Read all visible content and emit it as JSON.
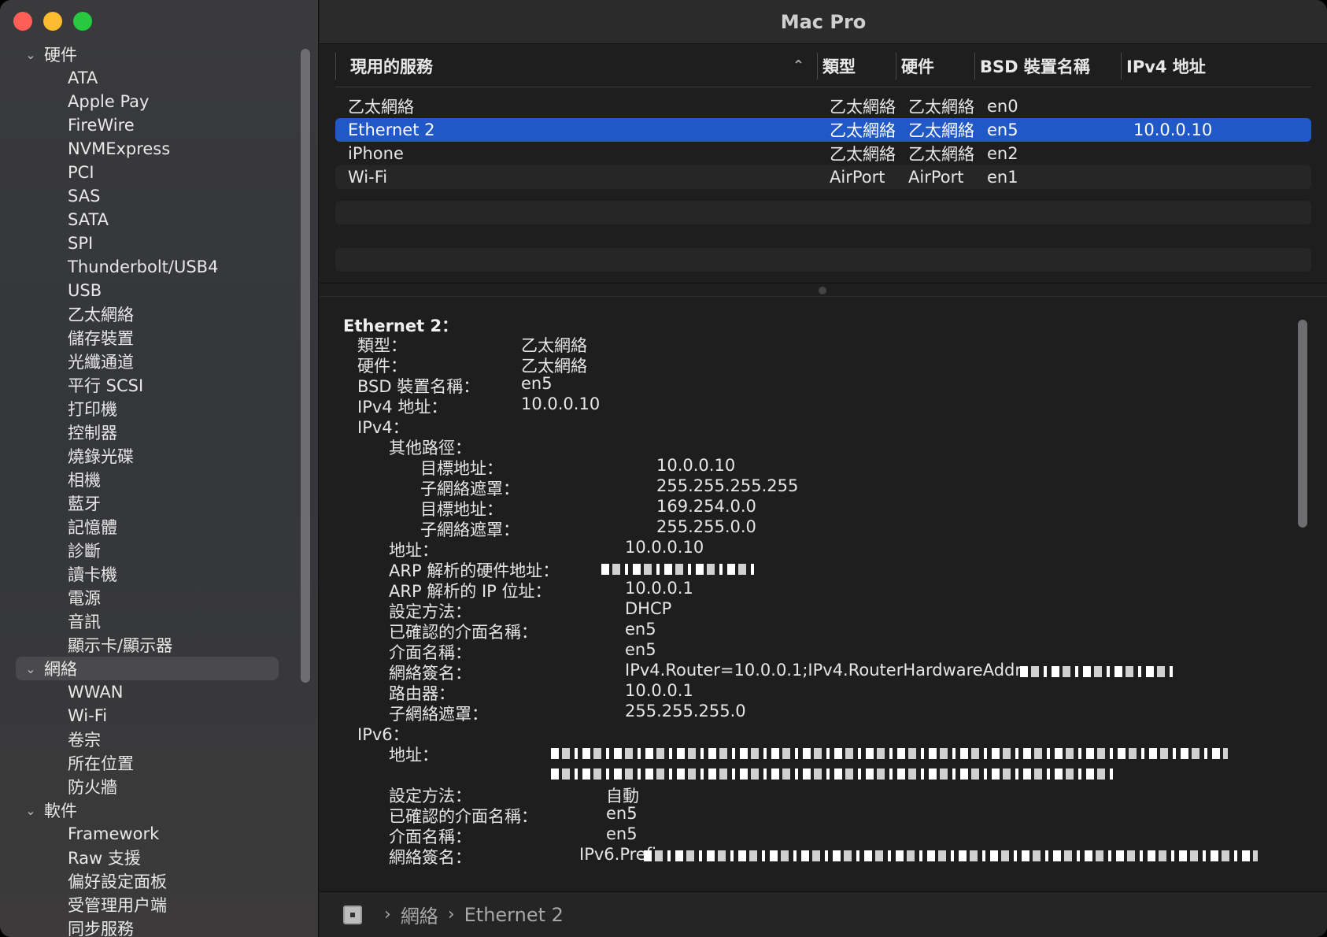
{
  "window": {
    "title": "Mac Pro"
  },
  "sidebar": {
    "groups": [
      {
        "label": "硬件",
        "items": [
          "ATA",
          "Apple Pay",
          "FireWire",
          "NVMExpress",
          "PCI",
          "SAS",
          "SATA",
          "SPI",
          "Thunderbolt/USB4",
          "USB",
          "乙太網絡",
          "儲存裝置",
          "光纖通道",
          "平行 SCSI",
          "打印機",
          "控制器",
          "燒錄光碟",
          "相機",
          "藍牙",
          "記憶體",
          "診斷",
          "讀卡機",
          "電源",
          "音訊",
          "顯示卡/顯示器"
        ]
      },
      {
        "label": "網絡",
        "items": [
          "WWAN",
          "Wi-Fi",
          "卷宗",
          "所在位置",
          "防火牆"
        ]
      },
      {
        "label": "軟件",
        "items": [
          "Framework",
          "Raw 支援",
          "偏好設定面板",
          "受管理用户端",
          "同步服務"
        ]
      }
    ]
  },
  "table": {
    "headers": [
      "現用的服務",
      "類型",
      "硬件",
      "BSD 裝置名稱",
      "IPv4 地址"
    ],
    "sort_indicator": "^",
    "rows": [
      [
        "乙太網絡",
        "乙太網絡",
        "乙太網絡",
        "en0",
        ""
      ],
      [
        "Ethernet 2",
        "乙太網絡",
        "乙太網絡",
        "en5",
        "10.0.0.10"
      ],
      [
        "iPhone",
        "乙太網絡",
        "乙太網絡",
        "en2",
        ""
      ],
      [
        "Wi-Fi",
        "AirPort",
        "AirPort",
        "en1",
        ""
      ]
    ],
    "selected_row": 1
  },
  "detail": {
    "title": "Ethernet 2：",
    "lines": [
      {
        "k": "類型：",
        "v": "乙太網絡"
      },
      {
        "k": "硬件：",
        "v": "乙太網絡"
      },
      {
        "k": "BSD 裝置名稱：",
        "v": "en5"
      },
      {
        "k": "IPv4 地址：",
        "v": "10.0.0.10"
      },
      {
        "k": "IPv4：",
        "v": ""
      },
      {
        "k": "其他路徑：",
        "v": ""
      },
      {
        "k": "目標地址：",
        "v": "10.0.0.10"
      },
      {
        "k": "子網絡遮罩：",
        "v": "255.255.255.255"
      },
      {
        "k": "目標地址：",
        "v": "169.254.0.0"
      },
      {
        "k": "子網絡遮罩：",
        "v": "255.255.0.0"
      },
      {
        "k": "地址：",
        "v": "10.0.0.10"
      },
      {
        "k": "ARP 解析的硬件地址：",
        "v": ""
      },
      {
        "k": "ARP 解析的 IP 位址：",
        "v": "10.0.0.1"
      },
      {
        "k": "設定方法：",
        "v": "DHCP"
      },
      {
        "k": "已確認的介面名稱：",
        "v": "en5"
      },
      {
        "k": "介面名稱：",
        "v": "en5"
      },
      {
        "k": "網絡簽名：",
        "v": "IPv4.Router=10.0.0.1;IPv4.RouterHardwareAddress="
      },
      {
        "k": "路由器：",
        "v": "10.0.0.1"
      },
      {
        "k": "子網絡遮罩：",
        "v": "255.255.255.0"
      },
      {
        "k": "IPv6：",
        "v": ""
      },
      {
        "k": "地址：",
        "v": ""
      },
      {
        "k": "設定方法：",
        "v": "自動"
      },
      {
        "k": "已確認的介面名稱：",
        "v": "en5"
      },
      {
        "k": "介面名稱：",
        "v": "en5"
      },
      {
        "k": "網絡簽名：",
        "v": "IPv6.Prefix="
      }
    ]
  },
  "pathbar": {
    "crumbs": [
      "網絡",
      "Ethernet 2"
    ],
    "separator": "›"
  },
  "colors": {
    "selection": "#2058c8",
    "close": "#ff5f57",
    "minimize": "#febc2e",
    "zoom": "#28c840"
  }
}
